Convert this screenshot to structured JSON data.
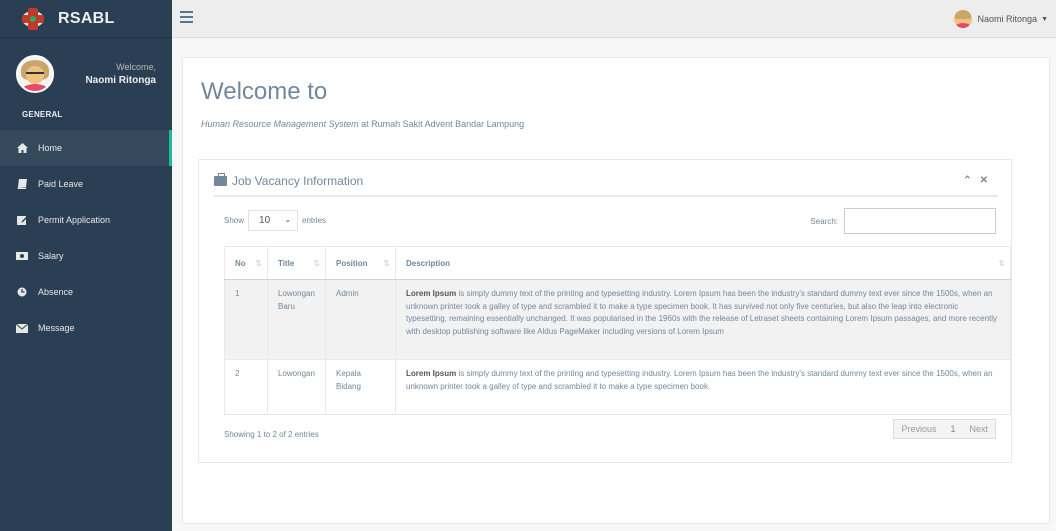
{
  "app": {
    "brand": "RSABL",
    "profile_welcome": "Welcome,",
    "profile_name": "Naomi Ritonga",
    "section": "GENERAL",
    "top_user": "Naomi Ritonga"
  },
  "menu": {
    "items": [
      {
        "label": "Home",
        "icon": "home-icon",
        "active": true
      },
      {
        "label": "Paid Leave",
        "icon": "book-icon"
      },
      {
        "label": "Permit Application",
        "icon": "edit-icon"
      },
      {
        "label": "Salary",
        "icon": "money-icon"
      },
      {
        "label": "Absence",
        "icon": "clock-icon"
      },
      {
        "label": "Message",
        "icon": "envelope-icon"
      }
    ]
  },
  "page": {
    "title": "Welcome to",
    "subtitle_em": "Human Resource Management System",
    "subtitle_rest": " at Rumah Sakit Advent Bandar Lampung"
  },
  "panel": {
    "title": "Job Vacancy Information",
    "show_label": "Show",
    "entries_value": "10",
    "entries_label": "entries",
    "search_label": "Search:",
    "search_value": "",
    "columns": [
      "No",
      "Title",
      "Position",
      "Description"
    ],
    "rows": [
      {
        "no": "1",
        "title": "Lowongan Baru",
        "position": "Admin",
        "desc_bold": "Lorem Ipsum",
        "desc": " is simply dummy text of the printing and typesetting industry. Lorem Ipsum has been the industry's standard dummy text ever since the 1500s, when an unknown printer took a galley of type and scrambled it to make a type specimen book. It has survived not only five centuries, but also the leap into electronic typesetting, remaining essentially unchanged. It was popularised in the 1960s with the release of Letraset sheets containing Lorem Ipsum passages, and more recently with desktop publishing software like Aldus PageMaker including versions of Lorem Ipsum"
      },
      {
        "no": "2",
        "title": "Lowongan",
        "position": "Kepala Bidang",
        "desc_bold": "Lorem Ipsum",
        "desc": " is simply dummy text of the printing and typesetting industry. Lorem Ipsum has been the industry's standard dummy text ever since the 1500s, when an unknown printer took a galley of type and scrambled it to make a type specimen book."
      }
    ],
    "info": "Showing 1 to 2 of 2 entries",
    "pager": {
      "prev": "Previous",
      "current": "1",
      "next": "Next"
    }
  },
  "colors": {
    "sidebar": "#2A3F54",
    "active_indicator": "#1ABB9C",
    "topbar": "#EDEDED",
    "text": "#73879C"
  }
}
